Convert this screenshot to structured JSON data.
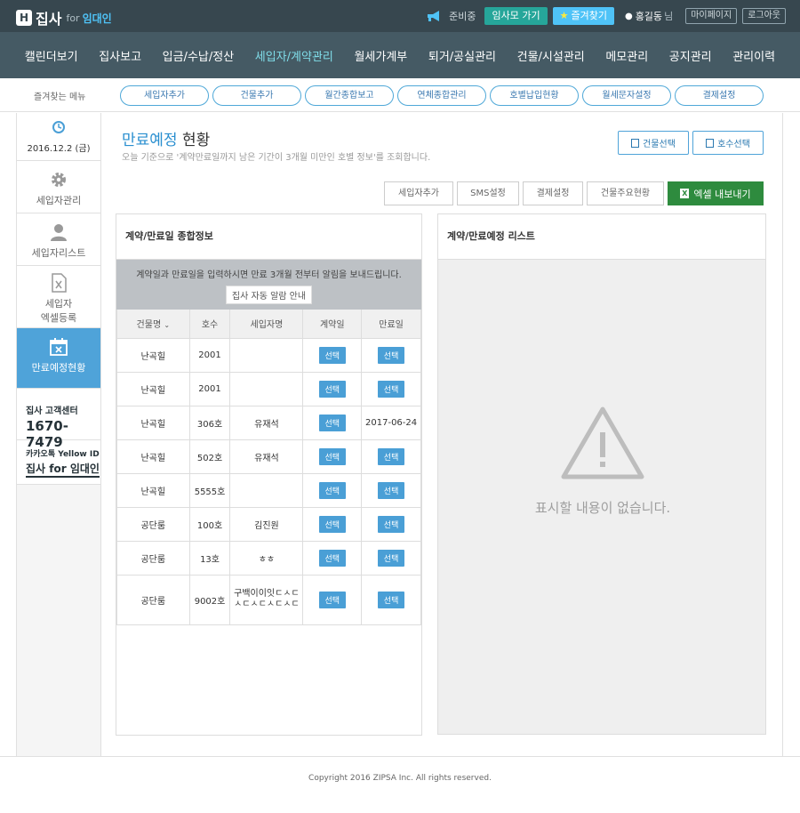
{
  "logo": {
    "main": "집사",
    "for": "for",
    "sub": "임대인"
  },
  "topbar": {
    "ready": "준비중",
    "go_label": "임사모 가기",
    "fav_label": "즐겨찾기",
    "user_name": "홍길동",
    "user_suffix": "님",
    "mypage": "마이페이지",
    "logout": "로그아웃"
  },
  "nav": [
    {
      "label": "캘린더보기"
    },
    {
      "label": "집사보고"
    },
    {
      "label": "입금/수납/정산"
    },
    {
      "label": "세입자/계약관리",
      "active": true
    },
    {
      "label": "월세가계부"
    },
    {
      "label": "퇴거/공실관리"
    },
    {
      "label": "건물/시설관리"
    },
    {
      "label": "메모관리"
    },
    {
      "label": "공지관리"
    },
    {
      "label": "관리이력"
    }
  ],
  "favbar": {
    "label": "즐겨찾는 메뉴",
    "items": [
      "세입자추가",
      "건물추가",
      "월간종합보고",
      "연체종합관리",
      "호별납입현황",
      "월세문자설정",
      "결제설정"
    ]
  },
  "sidebar": {
    "date": "2016.12.2 (금)",
    "items": [
      {
        "label": "세입자관리"
      },
      {
        "label": "세입자리스트"
      },
      {
        "label1": "세입자",
        "label2": "엑셀등록"
      },
      {
        "label": "만료예정현황"
      }
    ],
    "cs_title": "집사 고객센터",
    "cs_phone": "1670-7479",
    "ky_top": "카카오톡 Yellow ID",
    "ky_bottom": "집사 for 임대인"
  },
  "page": {
    "title_accent": "만료예정",
    "title_rest": " 현황",
    "desc": "오늘 기준으로 '계약만료일까지 남은 기간이 3개월 미만인 호별 정보'를 조회합니다.",
    "btn_building": "건물선택",
    "btn_room": "호수선택",
    "actions": [
      "세입자추가",
      "SMS설정",
      "결제설정",
      "건물주요현황"
    ],
    "excel": "엑셀 내보내기"
  },
  "left_panel": {
    "title": "계약/만료일 종합정보",
    "notice": "계약일과 만료일을 입력하시면 만료 3개월 전부터 알림을 보내드립니다.",
    "notice_btn": "집사 자동 알람 안내",
    "headers": [
      "건물명",
      "호수",
      "세입자명",
      "계약일",
      "만료일"
    ],
    "select_label": "선택",
    "rows": [
      {
        "building": "난곡힐",
        "room": "2001",
        "tenant": "",
        "contract": "",
        "expire": ""
      },
      {
        "building": "난곡힐",
        "room": "2001",
        "tenant": "",
        "contract": "",
        "expire": ""
      },
      {
        "building": "난곡힐",
        "room": "306호",
        "tenant": "유재석",
        "contract": "",
        "expire": "2017-06-24"
      },
      {
        "building": "난곡힐",
        "room": "502호",
        "tenant": "유재석",
        "contract": "",
        "expire": ""
      },
      {
        "building": "난곡힐",
        "room": "5555호",
        "tenant": "",
        "contract": "",
        "expire": ""
      },
      {
        "building": "공단룸",
        "room": "100호",
        "tenant": "김진원",
        "contract": "",
        "expire": ""
      },
      {
        "building": "공단룸",
        "room": "13호",
        "tenant": "ㅎㅎ",
        "contract": "",
        "expire": ""
      },
      {
        "building": "공단룸",
        "room": "9002호",
        "tenant": "구백이이잇ㄷㅅㄷㅅㄷㅅㄷㅅㄷㅅㄷ",
        "contract": "",
        "expire": ""
      }
    ]
  },
  "right_panel": {
    "title": "계약/만료예정 리스트",
    "empty": "표시할 내용이 없습니다."
  },
  "footer": "Copyright 2016 ZIPSA Inc. All rights reserved."
}
